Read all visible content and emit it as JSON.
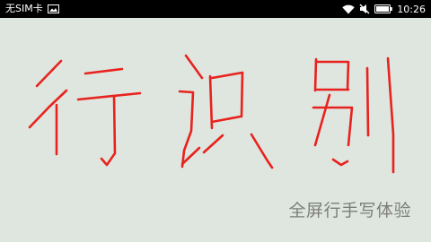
{
  "status_bar": {
    "carrier": "无SIM卡",
    "time": "10:26",
    "icons": [
      "image-notification-icon",
      "wifi-icon",
      "mute-icon",
      "battery-icon"
    ]
  },
  "canvas": {
    "ink_color": "#e8221e",
    "handwritten_text": "行识别"
  },
  "subtitle": "全屏行手写体验"
}
